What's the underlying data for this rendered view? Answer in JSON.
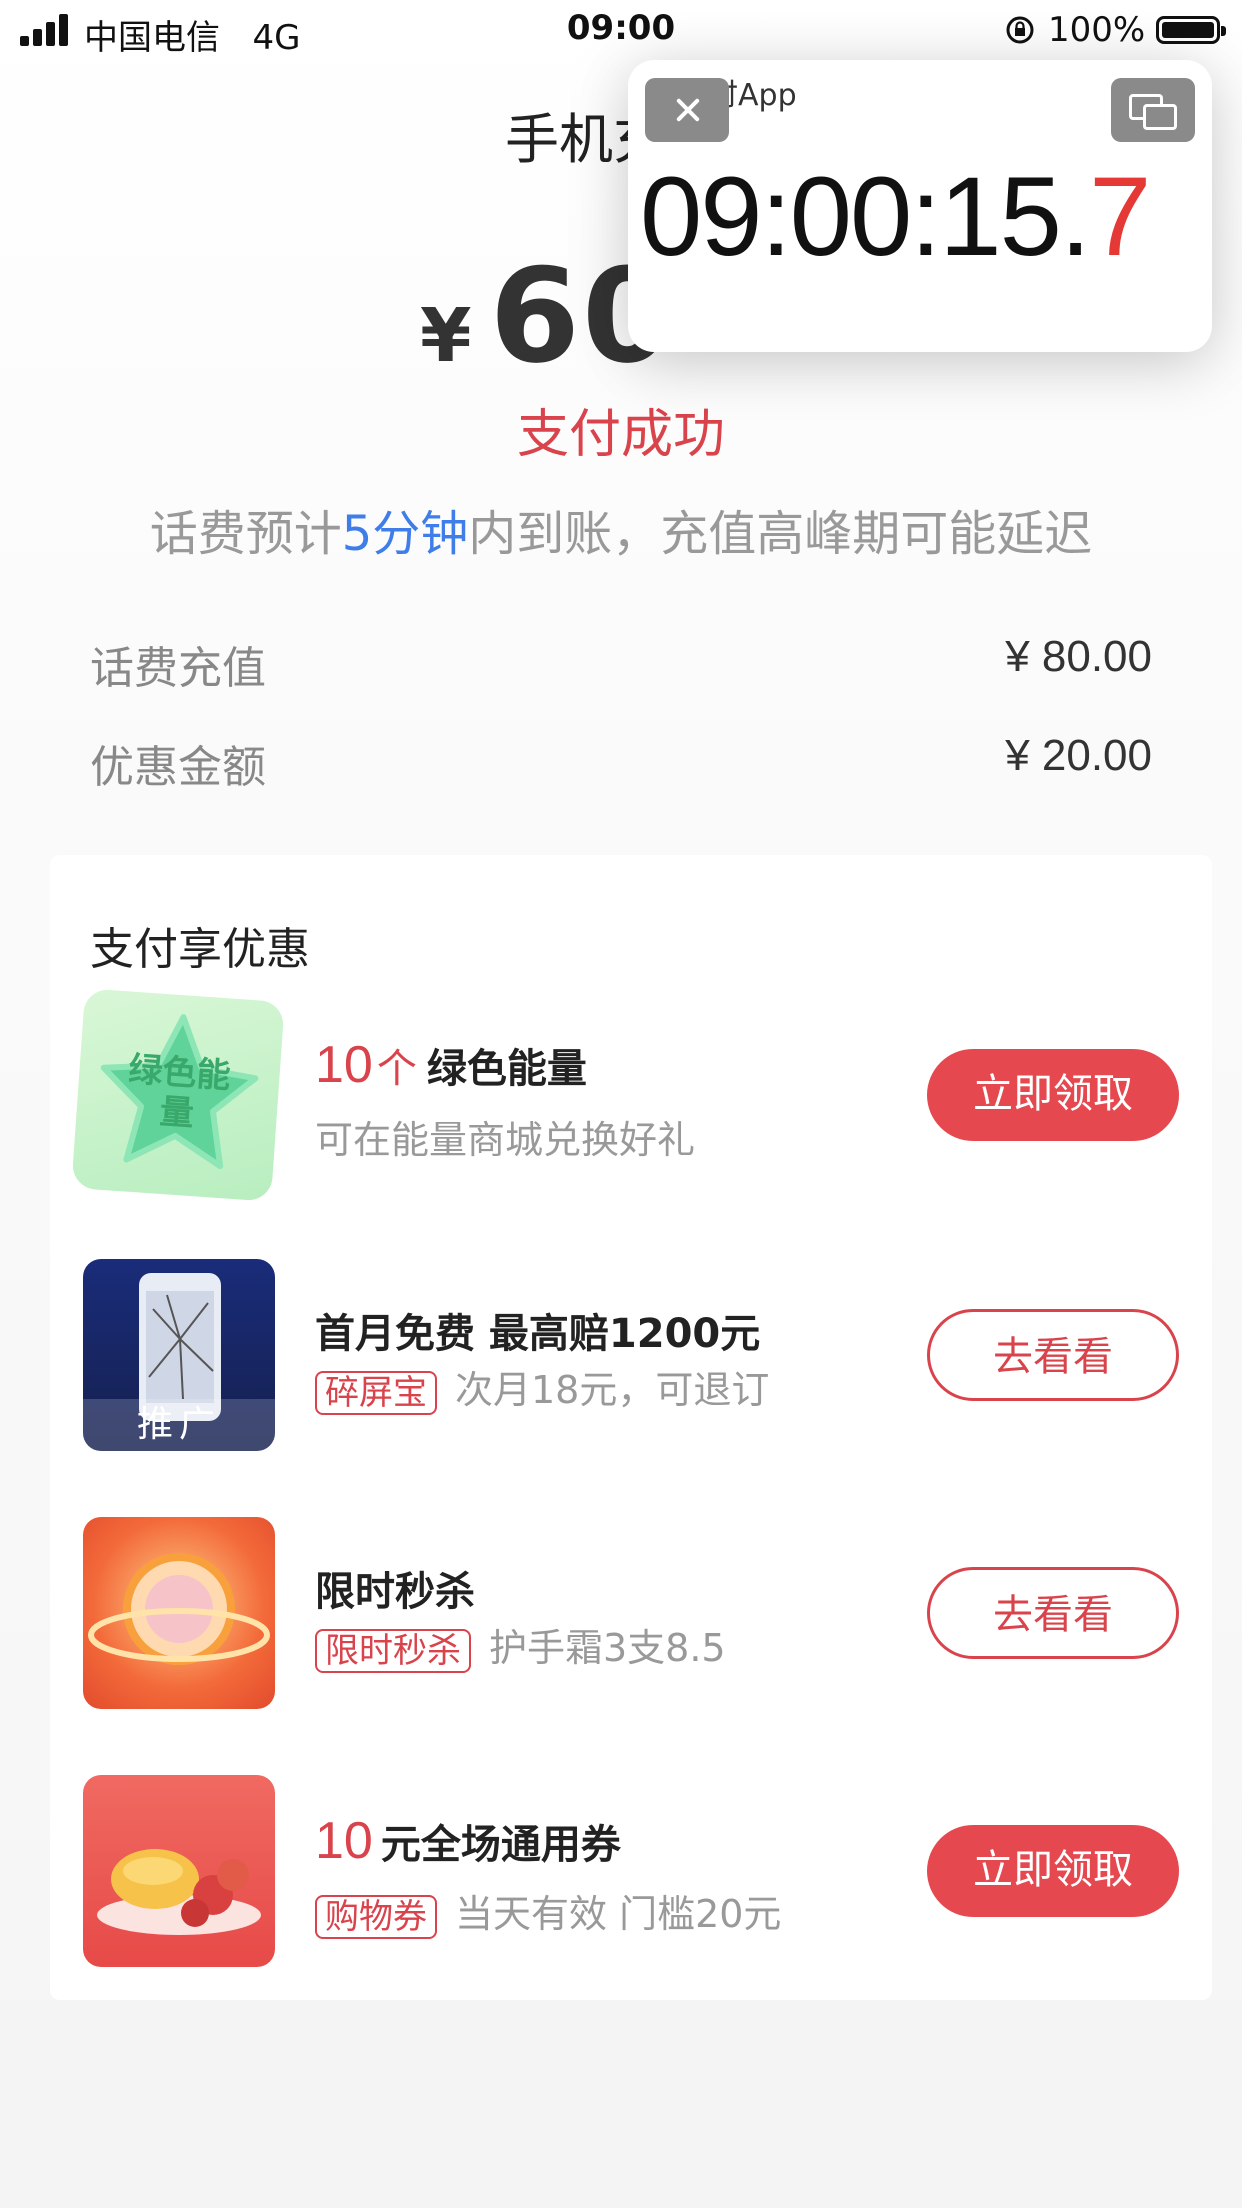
{
  "status_bar": {
    "carrier": "中国电信",
    "network": "4G",
    "time": "09:00",
    "battery": "100%"
  },
  "header": {
    "title": "手机充值",
    "currency": "¥",
    "amount": "60",
    "status": "支付成功",
    "notice_pre": "话费预计",
    "notice_highlight": "5分钟",
    "notice_post": "内到账，充值高峰期可能延迟"
  },
  "summary": [
    {
      "label": "话费充值",
      "value": "¥ 80.00"
    },
    {
      "label": "优惠金额",
      "value": "¥ 20.00"
    }
  ],
  "offers_section": {
    "title": "支付享优惠",
    "items": [
      {
        "thumb_text": "绿色能量",
        "title_number": "10",
        "title_unit": "个",
        "title_text": "绿色能量",
        "tag": "",
        "subtitle": "可在能量商城兑换好礼",
        "button": "立即领取"
      },
      {
        "thumb_text": "推广",
        "title_number": "",
        "title_unit": "",
        "title_text": "首月免费 最高赔1200元",
        "tag": "碎屏宝",
        "subtitle": "次月18元，可退订",
        "button": "去看看"
      },
      {
        "thumb_text": "",
        "title_number": "",
        "title_unit": "",
        "title_text": "限时秒杀",
        "tag": "限时秒杀",
        "subtitle": "护手霜3支8.5",
        "button": "去看看"
      },
      {
        "thumb_text": "",
        "title_number": "10",
        "title_unit": "元",
        "title_text": "全场通用券",
        "tag": "购物券",
        "subtitle": "当天有效 门槛20元",
        "button": "立即领取"
      }
    ]
  },
  "pip_timer": {
    "app_label": "计时App",
    "time_main": "09:00:15.",
    "time_last": "7"
  },
  "colors": {
    "accent_red": "#e5484f",
    "highlight_blue": "#3f7ee8"
  }
}
